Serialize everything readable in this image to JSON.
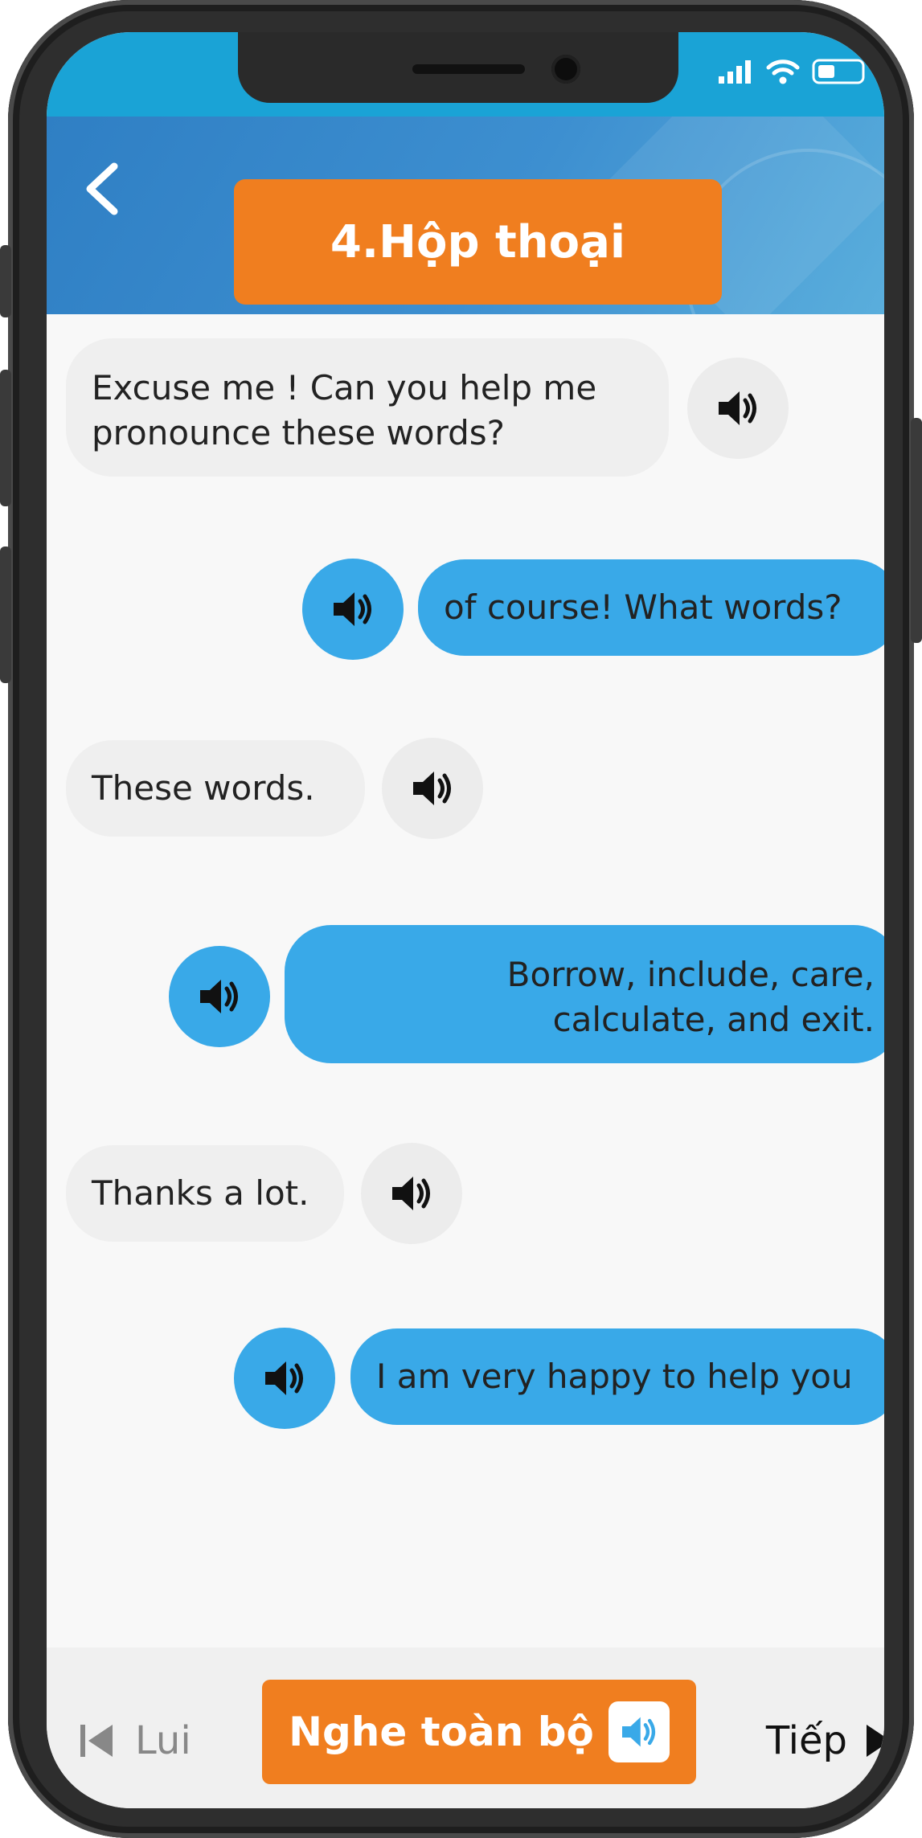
{
  "header": {
    "title": "4.Hộp thoại"
  },
  "dialog": [
    {
      "side": "left",
      "text_lines": [
        "Excuse me ! Can you help me",
        "pronounce these words?"
      ]
    },
    {
      "side": "right",
      "text_lines": [
        "of course! What words?"
      ]
    },
    {
      "side": "left",
      "text_lines": [
        "These words."
      ]
    },
    {
      "side": "right",
      "text_lines": [
        "Borrow, include, care,",
        "calculate, and exit."
      ]
    },
    {
      "side": "left",
      "text_lines": [
        "Thanks a lot."
      ]
    },
    {
      "side": "right",
      "text_lines": [
        "I am very happy to help you"
      ]
    }
  ],
  "footer": {
    "prev_label": "Lui",
    "play_all_label": "Nghe toàn bộ",
    "next_label": "Tiếp"
  },
  "colors": {
    "accent_orange": "#f07e1f",
    "bubble_blue": "#39a9e8",
    "header_blue": "#2f7fc4",
    "bubble_grey": "#efefef"
  },
  "icons": {
    "back": "chevron-left-icon",
    "speaker": "speaker-icon",
    "prev": "skip-previous-icon",
    "next": "skip-next-icon"
  }
}
